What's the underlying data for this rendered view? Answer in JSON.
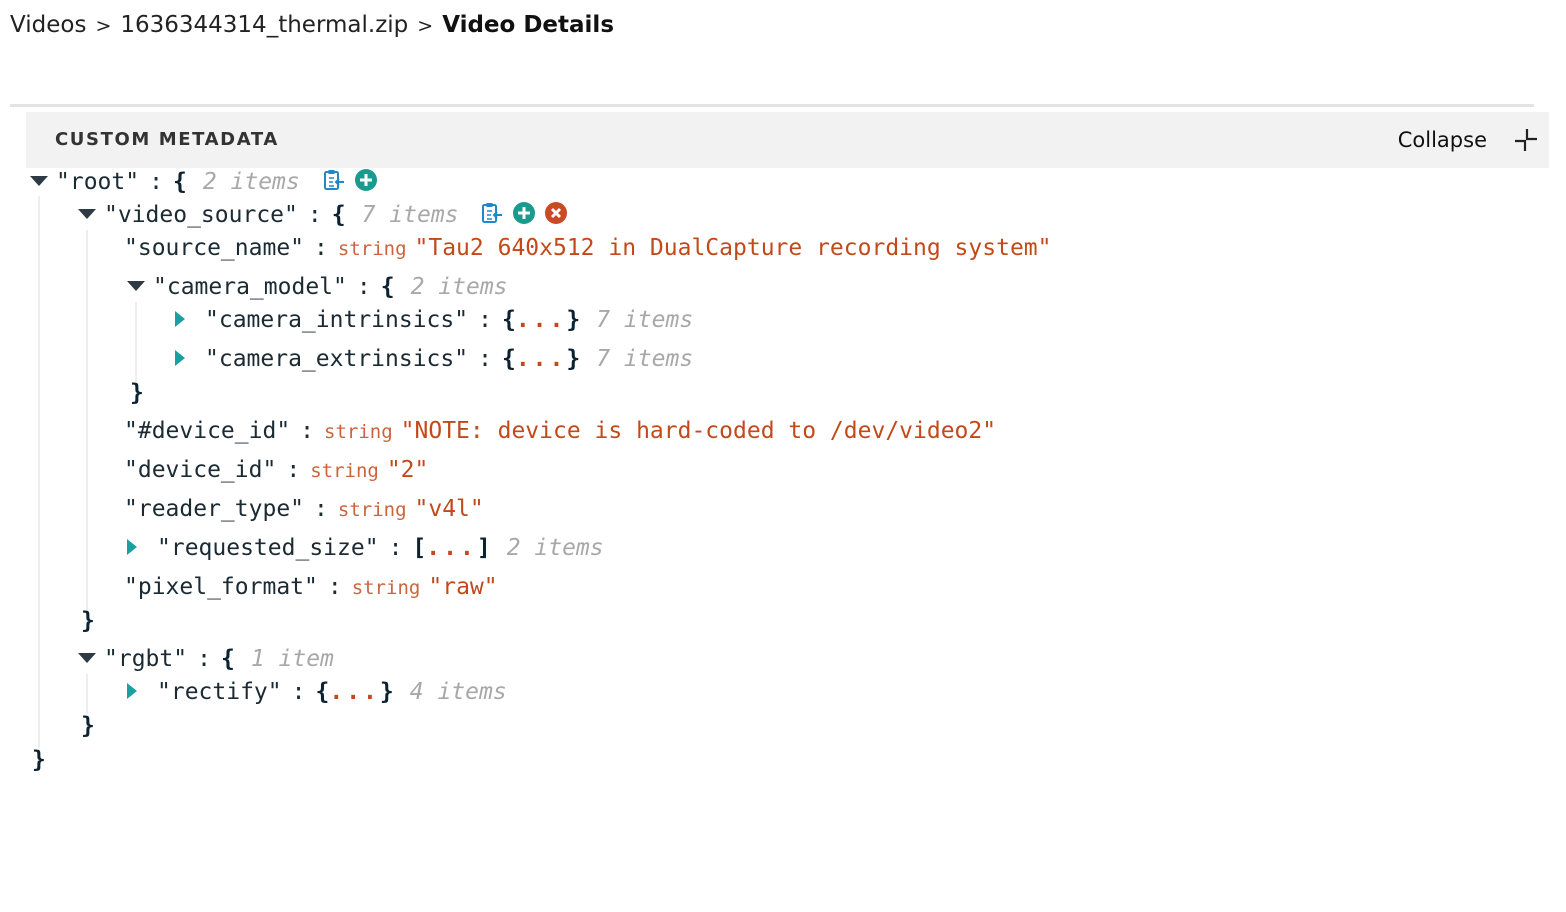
{
  "breadcrumb": {
    "items": [
      "Videos",
      "1636344314_thermal.zip"
    ],
    "separator": ">",
    "current": "Video Details"
  },
  "panel": {
    "title": "CUSTOM METADATA",
    "collapse_label": "Collapse",
    "collapse_icon": "collapse-icon"
  },
  "colors": {
    "string_value": "#c24a1a",
    "count": "#a8a8a8",
    "expand_arrow": "#1aa0a3",
    "add_icon": "#1b9b8f",
    "remove_icon": "#c94a24",
    "copy_icon": "#1e88c9"
  },
  "json": {
    "root": {
      "key": "\"root\"",
      "count": "2 items"
    },
    "video_source": {
      "key": "\"video_source\"",
      "count": "7 items"
    },
    "source_name": {
      "key": "\"source_name\"",
      "type": "string",
      "value": "\"Tau2 640x512 in DualCapture recording system\""
    },
    "camera_model": {
      "key": "\"camera_model\"",
      "count": "2 items"
    },
    "camera_intrinsics": {
      "key": "\"camera_intrinsics\"",
      "collapsed": "...",
      "count": "7 items"
    },
    "camera_extrinsics": {
      "key": "\"camera_extrinsics\"",
      "collapsed": "...",
      "count": "7 items"
    },
    "note_device_id": {
      "key": "\"#device_id\"",
      "type": "string",
      "value": "\"NOTE: device is hard-coded to /dev/video2\""
    },
    "device_id": {
      "key": "\"device_id\"",
      "type": "string",
      "value": "\"2\""
    },
    "reader_type": {
      "key": "\"reader_type\"",
      "type": "string",
      "value": "\"v4l\""
    },
    "requested_size": {
      "key": "\"requested_size\"",
      "collapsed": "...",
      "count": "2 items"
    },
    "pixel_format": {
      "key": "\"pixel_format\"",
      "type": "string",
      "value": "\"raw\""
    },
    "rgbt": {
      "key": "\"rgbt\"",
      "count": "1 item"
    },
    "rectify": {
      "key": "\"rectify\"",
      "collapsed": "...",
      "count": "4 items"
    },
    "colon": ":",
    "open_brace": "{",
    "close_brace": "}",
    "open_bracket": "[",
    "close_bracket": "]"
  }
}
